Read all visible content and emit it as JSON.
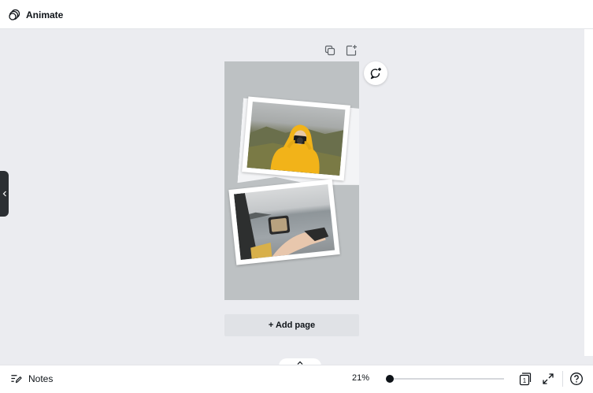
{
  "topbar": {
    "animate_label": "Animate"
  },
  "canvas": {
    "add_page_label": "+ Add page"
  },
  "footer": {
    "notes_label": "Notes",
    "zoom_percent": "21%",
    "page_count": "1"
  },
  "colors": {
    "page_background": "#bdc1c3",
    "photo1_jacket": "#f2b319",
    "canvas_background": "#ebecf0"
  },
  "icons": {
    "animate": "animate-icon",
    "duplicate": "duplicate-page-icon",
    "add": "add-page-icon",
    "ai": "magic-comment-icon",
    "notes": "notes-icon",
    "pages": "page-count-icon",
    "fullscreen": "fullscreen-icon",
    "help": "help-icon",
    "collapse": "chevron-left-icon",
    "expand": "chevron-up-icon"
  }
}
